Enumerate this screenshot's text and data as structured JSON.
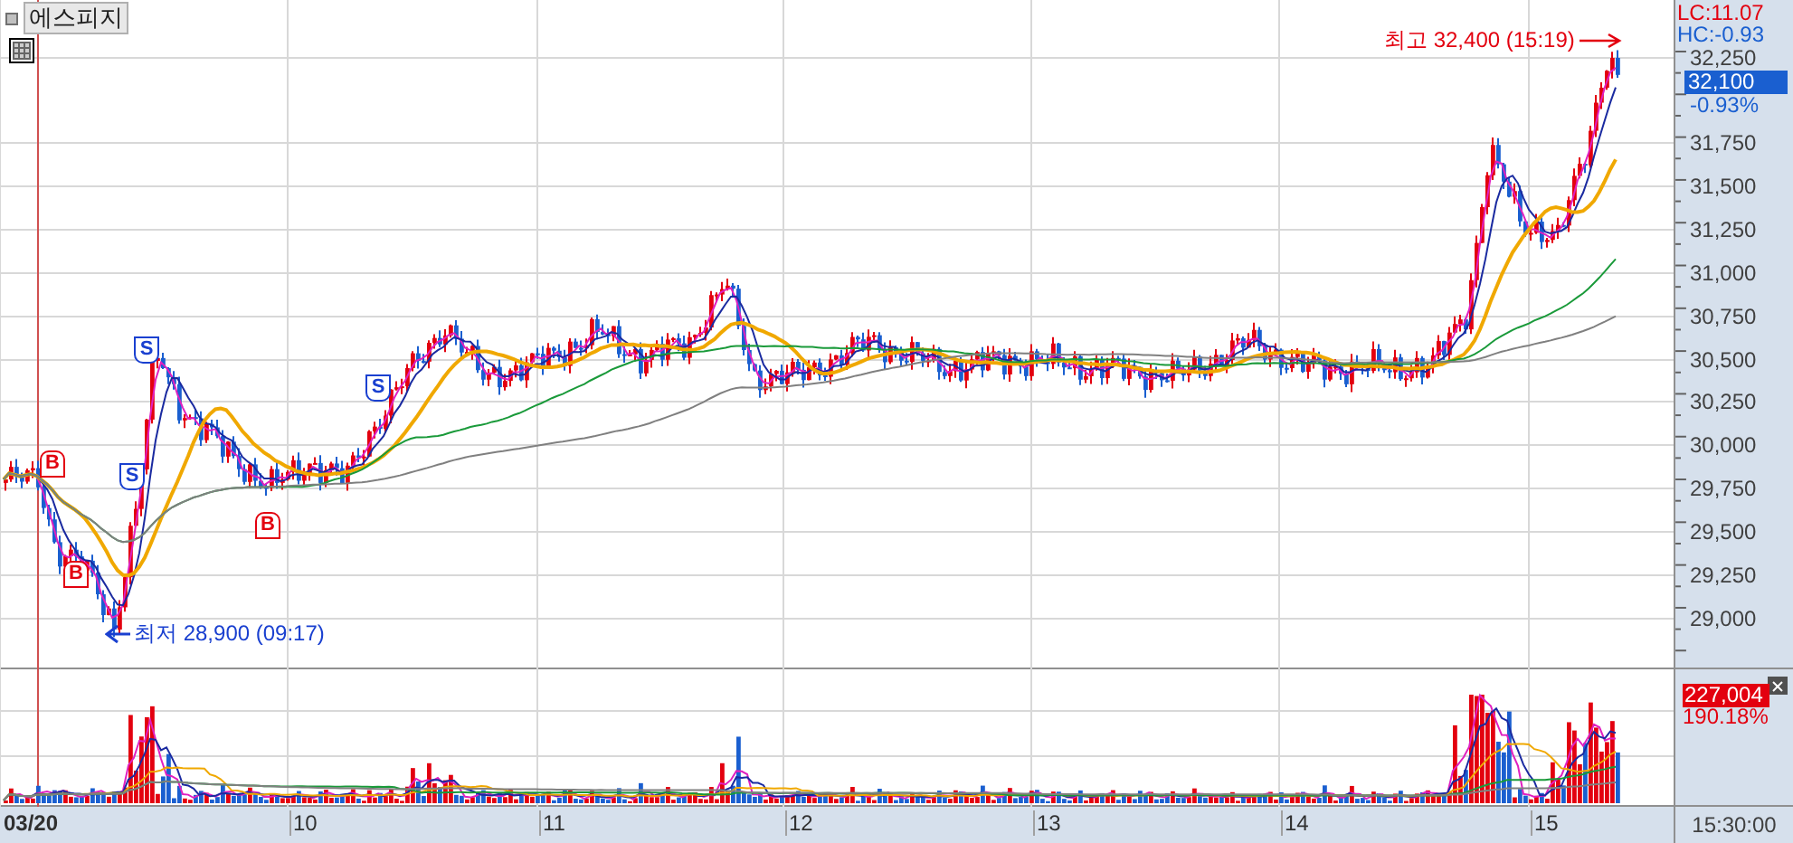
{
  "title": "에스피지",
  "price_axis": {
    "lc": "LC:11.07",
    "hc": "HC:-0.93",
    "ticks": [
      "32,250",
      "31,750",
      "31,500",
      "31,250",
      "31,000",
      "30,750",
      "30,500",
      "30,250",
      "30,000",
      "29,750",
      "29,500",
      "29,250",
      "29,000"
    ],
    "current_price": "32,100",
    "change": "-0.93%"
  },
  "annotations": [
    {
      "kind": "high",
      "text": "최고 32,400 (15:19)"
    },
    {
      "kind": "low",
      "text": "최저 28,900 (09:17)"
    }
  ],
  "signals": [
    {
      "kind": "buy",
      "text": "B"
    },
    {
      "kind": "buy",
      "text": "B"
    },
    {
      "kind": "buy",
      "text": "B"
    },
    {
      "kind": "sell",
      "text": "S"
    },
    {
      "kind": "sell",
      "text": "S"
    },
    {
      "kind": "sell",
      "text": "S"
    }
  ],
  "volume_axis": {
    "volume": "227,004",
    "ratio": "190.18%"
  },
  "time_axis": {
    "labels": [
      "03/20",
      "10",
      "11",
      "12",
      "13",
      "14",
      "15"
    ],
    "end_time": "15:30:00"
  }
}
